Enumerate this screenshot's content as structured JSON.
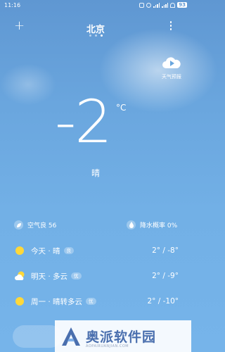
{
  "status_bar": {
    "time": "11:16",
    "battery": "93"
  },
  "header": {
    "city": "北京"
  },
  "forecast_button": {
    "label": "天气预报"
  },
  "current": {
    "temperature": "-2",
    "unit": "°C",
    "condition": "晴"
  },
  "info": {
    "aqi": "空气良 56",
    "rain": "降水概率 0%"
  },
  "forecast": [
    {
      "day": "今天 · 晴",
      "badge": "良",
      "range": "2° / -8°",
      "icon": "sun-icon"
    },
    {
      "day": "明天 · 多云",
      "badge": "优",
      "range": "2° / -9°",
      "icon": "partly-cloudy-icon"
    },
    {
      "day": "周一 · 晴转多云",
      "badge": "优",
      "range": "2° / -10°",
      "icon": "sun-icon"
    }
  ],
  "watermark": {
    "text": "奥派软件园",
    "sub": "AOPAIRUANJIAN.COM"
  },
  "colors": {
    "sky": "#6aa6de",
    "sun": "#ffd83a"
  }
}
